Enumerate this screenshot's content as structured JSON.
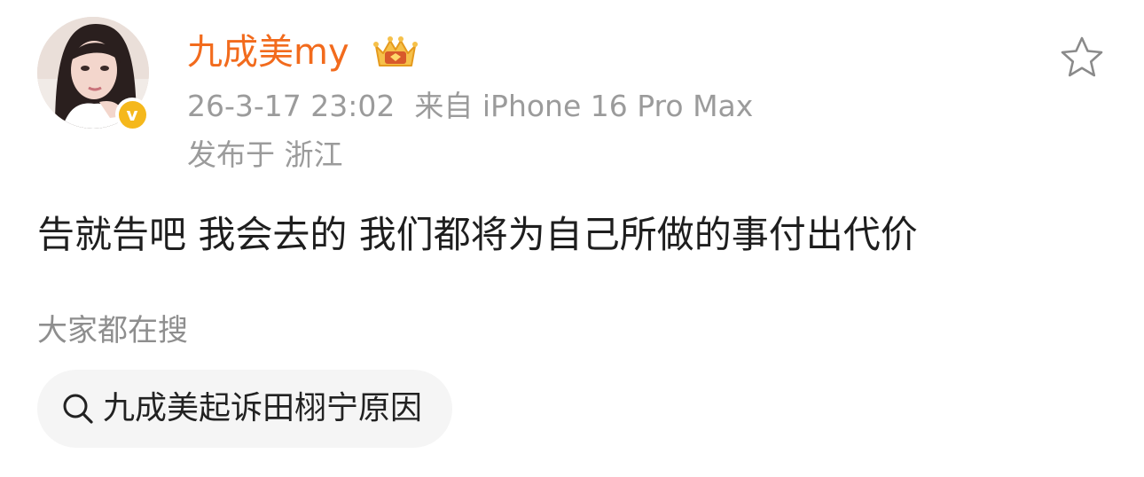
{
  "post": {
    "author": {
      "name": "九成美my",
      "verified_badge_letter": "v",
      "badge_icon": "crown-icon"
    },
    "timestamp": "26-3-17 23:02",
    "source": "来自 iPhone 16 Pro Max",
    "location": "发布于 浙江",
    "text": "告就告吧 我会去的 我们都将为自己所做的事付出代价",
    "favorite_icon": "star-outline-icon"
  },
  "related_search": {
    "title": "大家都在搜",
    "query": "九成美起诉田栩宁原因",
    "icon": "search-icon"
  },
  "colors": {
    "username": "#f26b1d",
    "meta": "#9b9b9b",
    "verified": "#f5b81c",
    "chip_background": "#f5f5f5"
  }
}
